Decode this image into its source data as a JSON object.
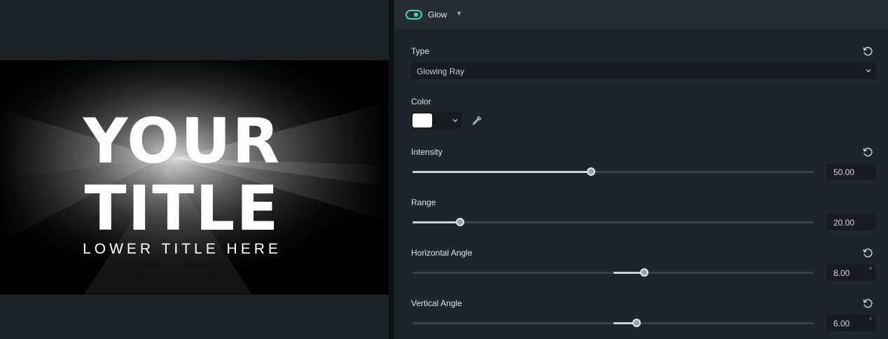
{
  "preview": {
    "title_line1": "YOUR",
    "title_line2": "TITLE",
    "lower_title": "LOWER TITLE HERE"
  },
  "panel": {
    "header": {
      "title": "Glow",
      "enabled": true,
      "toggle_color": "#3fd8b8"
    },
    "type": {
      "label": "Type",
      "value": "Glowing Ray"
    },
    "color": {
      "label": "Color",
      "value": "#ffffff"
    },
    "sliders": [
      {
        "key": "intensity",
        "label": "Intensity",
        "value": "50.00",
        "unit": "",
        "fill_from": 0,
        "position": 0.445,
        "has_reset": true
      },
      {
        "key": "range",
        "label": "Range",
        "value": "20.00",
        "unit": "",
        "fill_from": 0,
        "position": 0.118,
        "has_reset": false
      },
      {
        "key": "horizontal_angle",
        "label": "Horizontal Angle",
        "value": "8.00",
        "unit": "°",
        "fill_from": 0.5,
        "position": 0.578,
        "has_reset": true
      },
      {
        "key": "vertical_angle",
        "label": "Vertical Angle",
        "value": "6.00",
        "unit": "°",
        "fill_from": 0.5,
        "position": 0.559,
        "has_reset": true
      }
    ]
  }
}
